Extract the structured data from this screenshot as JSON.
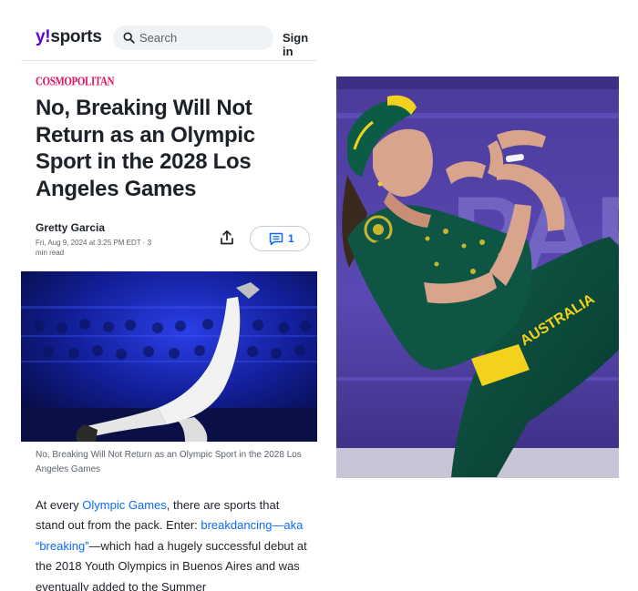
{
  "header": {
    "logo_y": "y",
    "logo_bang": "!",
    "logo_sports": "sports",
    "search_placeholder": "Search",
    "signin_label": "Sign in"
  },
  "article": {
    "source": "COSMOPOLITAN",
    "headline": "No, Breaking Will Not Return as an Olympic Sport in the 2028 Los Angeles Games",
    "author": "Gretty Garcia",
    "dateline": "Fri, Aug 9, 2024 at 3:25 PM EDT · 3 min read",
    "comment_count": "1",
    "caption": "No, Breaking Will Not Return as an Olympic Sport in the 2028 Los Angeles Games",
    "body": {
      "p1_a": "At every ",
      "link1": "Olympic Games",
      "p1_b": ", there are sports that stand out from the pack. Enter: ",
      "link2": "breakdancing—aka “breaking”",
      "p1_c": "—which had a hugely successful debut at the 2018 Youth Olympics in Buenos Aires and was eventually added to the Summer"
    }
  },
  "photo": {
    "jersey_text": "AUSTRALIA",
    "background_text": "PAR"
  },
  "colors": {
    "brand_purple": "#6001d2",
    "source_pink": "#e0115f",
    "link_blue": "#0f69ff",
    "aus_green": "#0d4a3c",
    "aus_gold": "#f2d21c"
  }
}
